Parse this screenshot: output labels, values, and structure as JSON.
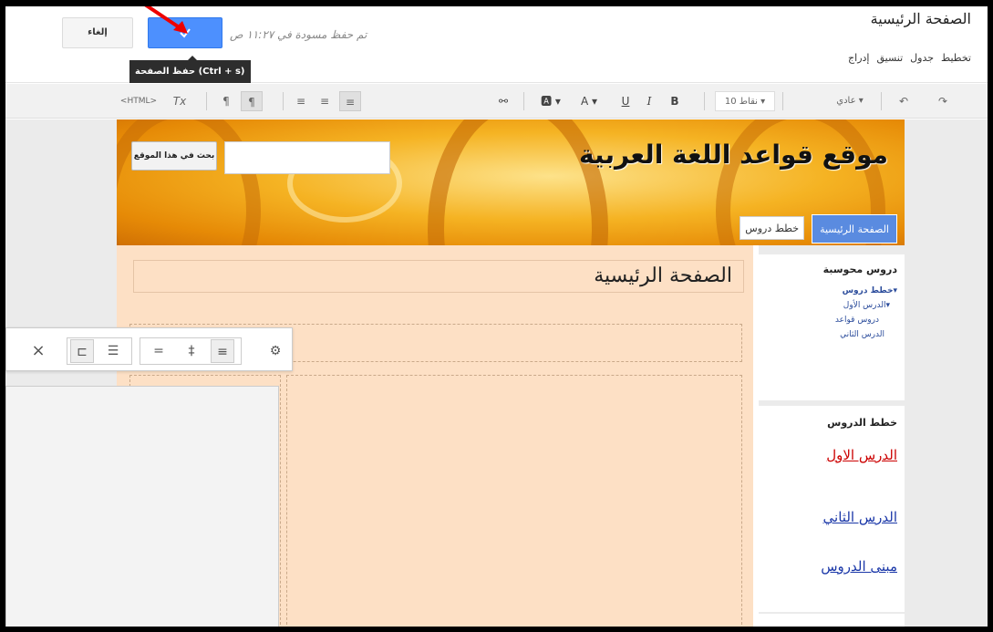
{
  "header": {
    "page_title": "الصفحة الرئيسية",
    "menu": [
      "إدراج",
      "تنسيق",
      "جدول",
      "تخطيط"
    ],
    "cancel_label": "إلغاء",
    "draft_status": "تم حفظ مسودة في ١١:٢٧ ص",
    "tooltip": "حفظ الصفحة (Ctrl + s)"
  },
  "toolbar": {
    "style_select": "عادي",
    "size_select": "10 نقاط",
    "bold": "B",
    "italic": "I",
    "underline": "U",
    "html": "<HTML>"
  },
  "site": {
    "title": "موقع قواعد اللغة العربية",
    "search_button": "بحث في هذا الموقع",
    "search_placeholder": "",
    "nav": {
      "home": "الصفحة الرئيسية",
      "plans": "خطط دروس"
    },
    "content_title": "الصفحة الرئيسية",
    "sidebar1": {
      "heading": "دروس محوسبة",
      "items": [
        "▾خطط دروس",
        "▾الدرس الأول",
        "دروس قواعد",
        "الدرس الثاني"
      ]
    },
    "sidebar2": {
      "heading": "خطط الدروس",
      "links": [
        "الدرس الاول",
        "الدرس الثاني",
        "مبنى الدروس"
      ]
    }
  },
  "colors": {
    "save_blue": "#4d90fe",
    "link_red": "#cc0000",
    "link_blue": "#1a37a8",
    "banner_orange": "#f5b323",
    "content_bg": "#fde0c5"
  }
}
